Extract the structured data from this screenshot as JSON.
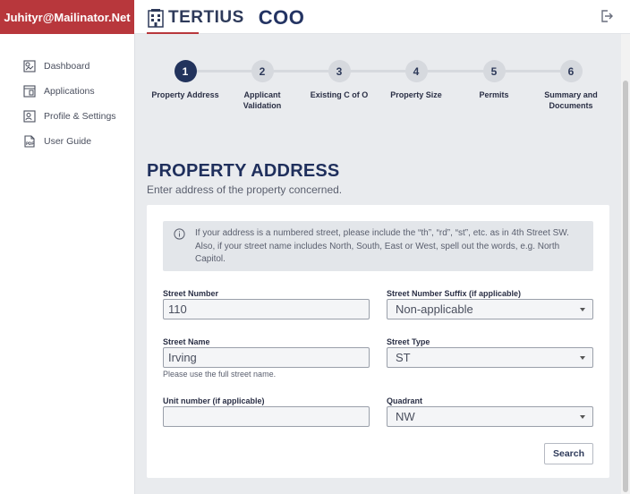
{
  "header": {
    "user_email": "Juhityr@Mailinator.Net",
    "brand_name": "TERTIUS",
    "brand_sub": "COO",
    "logout_icon": "logout-icon"
  },
  "sidebar": {
    "items": [
      {
        "label": "Dashboard",
        "icon": "dashboard-icon"
      },
      {
        "label": "Applications",
        "icon": "applications-icon"
      },
      {
        "label": "Profile & Settings",
        "icon": "profile-icon"
      },
      {
        "label": "User Guide",
        "icon": "pdf-icon"
      }
    ]
  },
  "stepper": {
    "steps": [
      {
        "number": "1",
        "label": "Property Address",
        "active": true
      },
      {
        "number": "2",
        "label": "Applicant Validation",
        "active": false
      },
      {
        "number": "3",
        "label": "Existing C of O",
        "active": false
      },
      {
        "number": "4",
        "label": "Property Size",
        "active": false
      },
      {
        "number": "5",
        "label": "Permits",
        "active": false
      },
      {
        "number": "6",
        "label": "Summary and Documents",
        "active": false
      }
    ]
  },
  "page": {
    "title": "PROPERTY ADDRESS",
    "subtitle": "Enter address of the property concerned."
  },
  "info": {
    "text": "If your address is a numbered street, please include the “th”, “rd”, “st”, etc. as in 4th Street SW. Also, if your street name includes North, South, East or West, spell out the words, e.g. North Capitol."
  },
  "form": {
    "street_number": {
      "label": "Street Number",
      "value": "110"
    },
    "street_number_suffix": {
      "label": "Street Number Suffix (if applicable)",
      "value": "Non-applicable"
    },
    "street_name": {
      "label": "Street Name",
      "value": "Irving",
      "help": "Please use the full street name."
    },
    "street_type": {
      "label": "Street Type",
      "value": "ST"
    },
    "unit_number": {
      "label": "Unit number (if applicable)",
      "value": ""
    },
    "quadrant": {
      "label": "Quadrant",
      "value": "NW"
    },
    "search_label": "Search"
  },
  "colors": {
    "accent_red": "#b8373c",
    "navy": "#22335c",
    "background": "#e9ebee"
  }
}
